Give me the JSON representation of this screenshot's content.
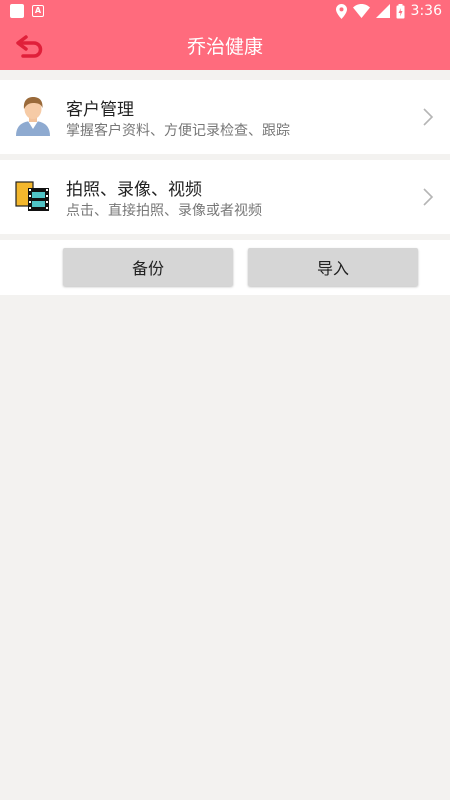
{
  "status_bar": {
    "time": "3:36"
  },
  "app_bar": {
    "title": "乔治健康"
  },
  "menu": [
    {
      "title": "客户管理",
      "subtitle": "掌握客户资料、方便记录检查、跟踪"
    },
    {
      "title": "拍照、录像、视频",
      "subtitle": "点击、直接拍照、录像或者视频"
    }
  ],
  "actions": {
    "backup_label": "备份",
    "import_label": "导入"
  },
  "colors": {
    "accent": "#ff6b7d",
    "back_icon": "#e0203a",
    "background": "#f3f2f0",
    "button": "#d6d6d6"
  }
}
